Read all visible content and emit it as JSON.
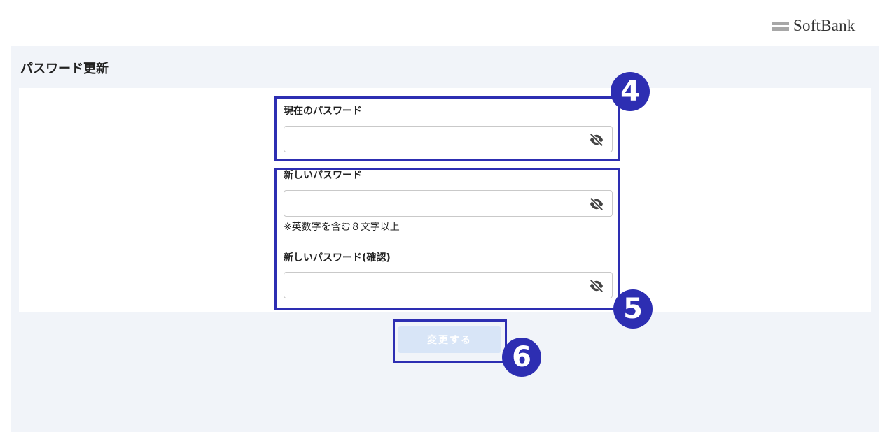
{
  "brand": {
    "logo_text": "SoftBank"
  },
  "page": {
    "title": "パスワード更新"
  },
  "form": {
    "current_password": {
      "label": "現在のパスワード",
      "value": "",
      "toggle_icon": "eye-slash-icon"
    },
    "new_password": {
      "label": "新しいパスワード",
      "value": "",
      "hint": "※英数字を含む８文字以上",
      "toggle_icon": "eye-slash-icon"
    },
    "confirm_password": {
      "label": "新しいパスワード(確認)",
      "value": "",
      "toggle_icon": "eye-slash-icon"
    },
    "submit_label": "変更する",
    "submit_enabled": false
  },
  "annotations": [
    {
      "number": "4"
    },
    {
      "number": "5"
    },
    {
      "number": "6"
    }
  ],
  "colors": {
    "annotation": "#2d2eb2",
    "panel_bg": "#f1f4f9",
    "button_disabled_bg": "#d8e5f7",
    "logo_mark": "#a7a7a7"
  }
}
